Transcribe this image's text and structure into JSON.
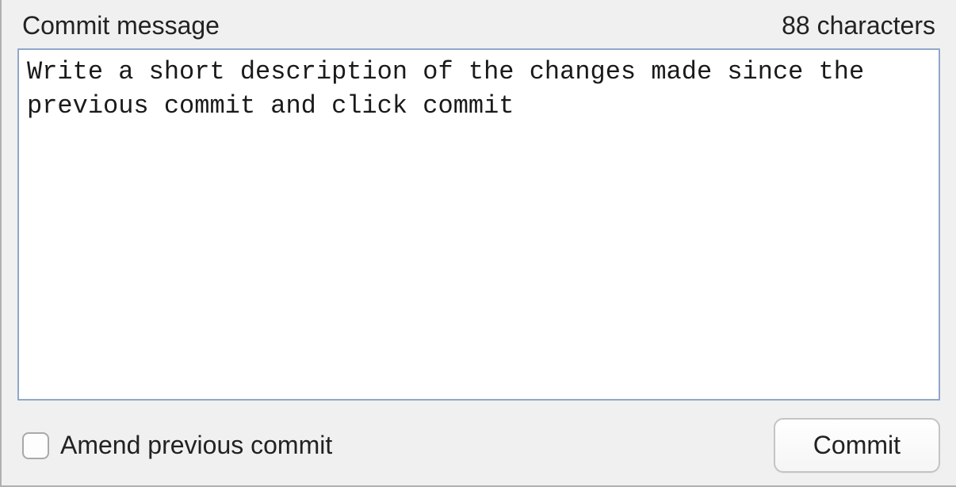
{
  "header": {
    "label": "Commit message",
    "character_count_text": "88 characters"
  },
  "message": {
    "value": "Write a short description of the changes made since the previous commit and click commit"
  },
  "footer": {
    "amend_label": "Amend previous commit",
    "amend_checked": false,
    "commit_button_label": "Commit"
  }
}
